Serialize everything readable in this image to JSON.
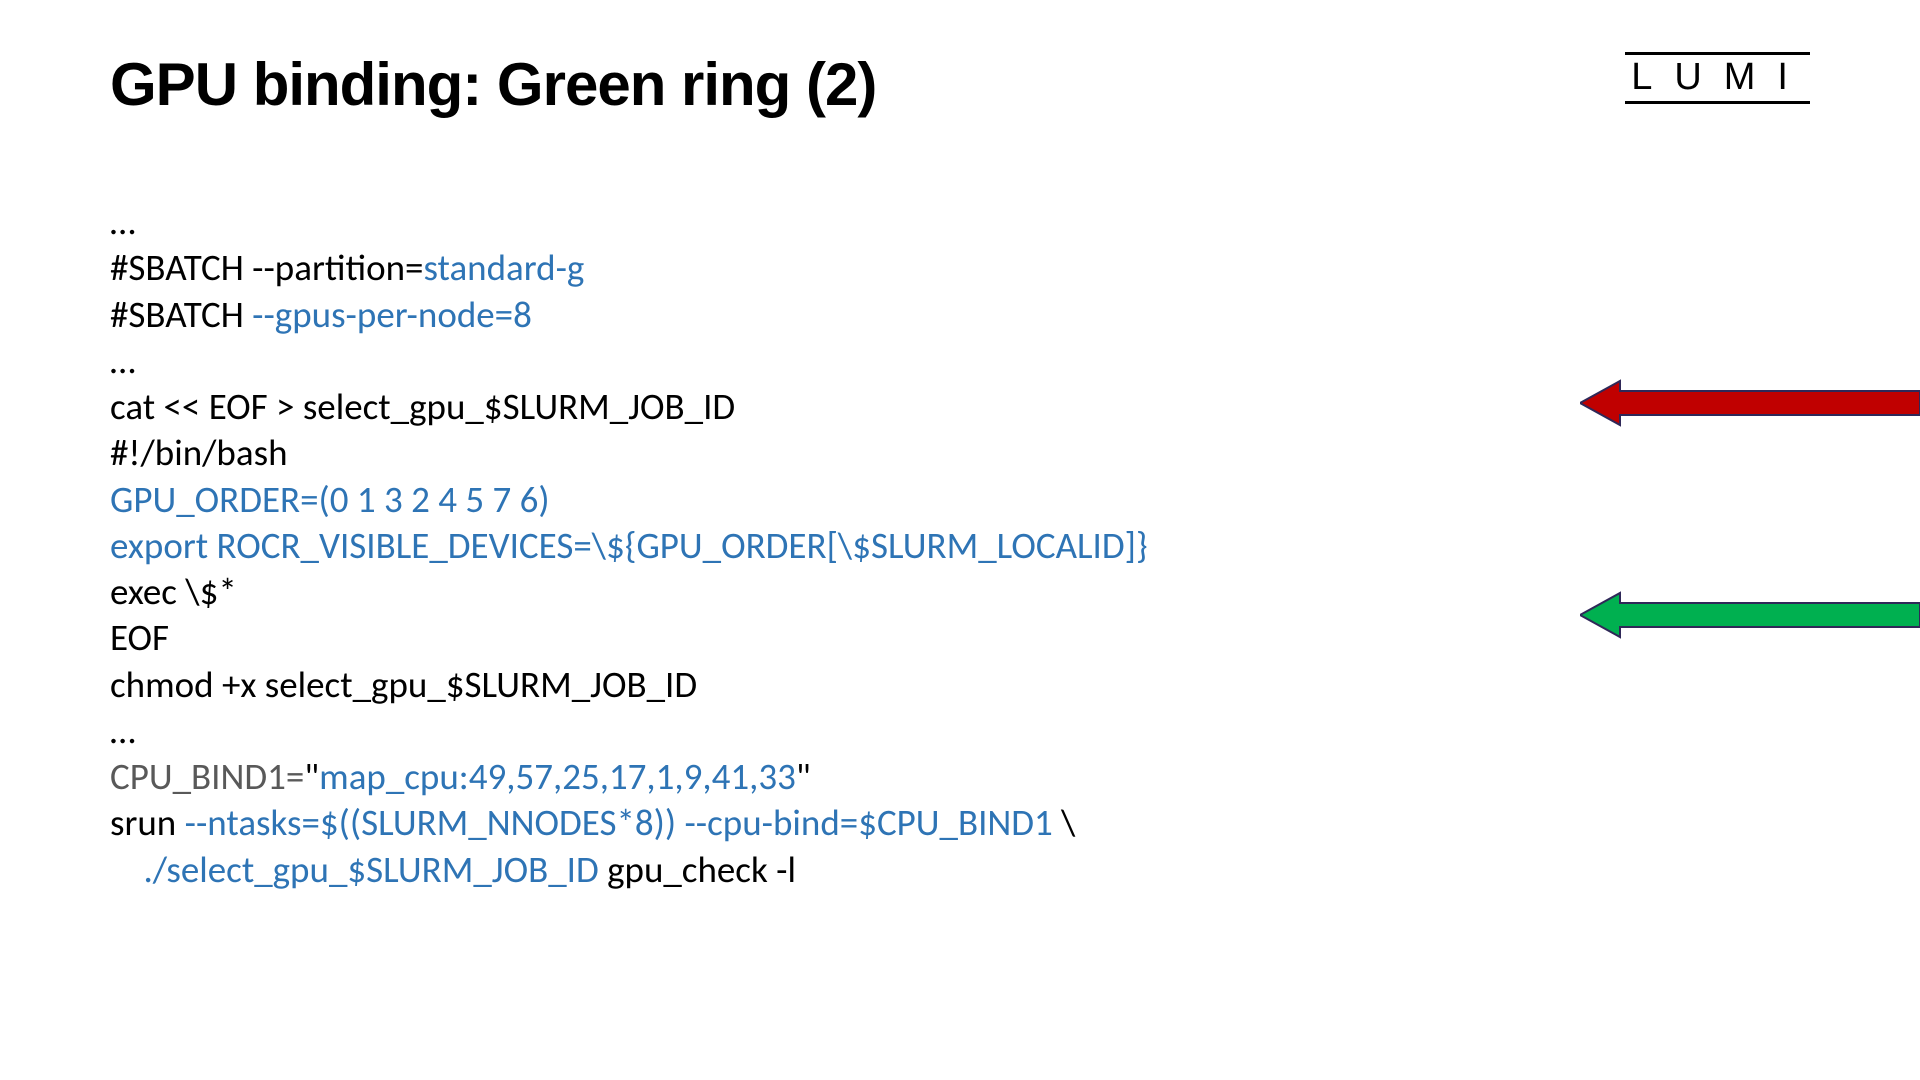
{
  "title": "GPU binding: Green ring (2)",
  "logo": "LUMI",
  "code": {
    "l1": "…",
    "l2a": "#SBATCH --partition=",
    "l2b": "standard-g",
    "l3a": "#SBATCH ",
    "l3b": "--gpus-per-node=8",
    "l4": "…",
    "l5": "cat << EOF > select_gpu_$SLURM_JOB_ID",
    "l6": "#!/bin/bash",
    "l7": "GPU_ORDER=(0 1 3 2 4 5 7 6)",
    "l8": "export ROCR_VISIBLE_DEVICES=\\${GPU_ORDER[\\$SLURM_LOCALID]}",
    "l9": "exec \\$*",
    "l10": "EOF",
    "l11": "chmod +x select_gpu_$SLURM_JOB_ID",
    "l12": "…",
    "l13a": "CPU_BIND1=",
    "l13b": "\"",
    "l13c": "map_cpu:49,57,25,17,1,9,41,33",
    "l13d": "\"",
    "l14a": "srun ",
    "l14b": "--ntasks=$((SLURM_NNODES*8)) --cpu-bind=$CPU_BIND1",
    "l14c": " \\",
    "l15a": "    ",
    "l15b": "./select_gpu_$SLURM_JOB_ID",
    "l15c": " gpu_check -l"
  },
  "arrows": {
    "red_fill": "#C00000",
    "red_stroke": "#2F2858",
    "green_fill": "#00B050",
    "green_stroke": "#2F2858"
  }
}
